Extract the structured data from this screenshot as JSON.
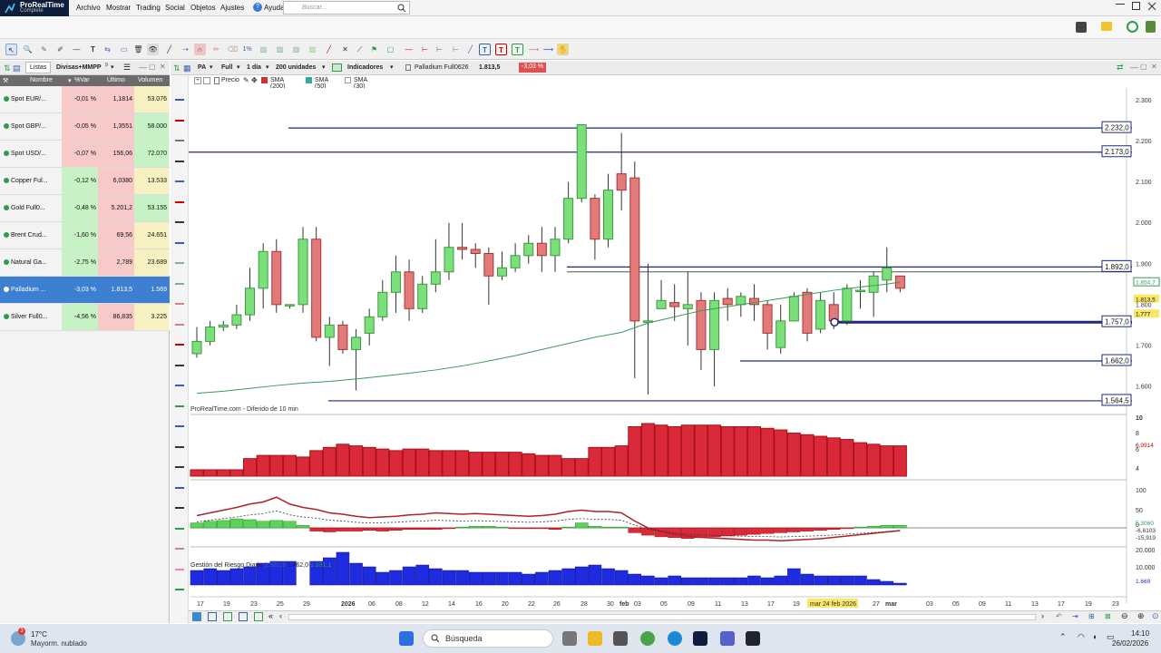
{
  "app": {
    "name": "ProRealTime",
    "edition": "Complete"
  },
  "menu": [
    "Archivo",
    "Mostrar",
    "Trading",
    "Social",
    "Objetos",
    "Ajustes",
    "Ayuda"
  ],
  "search": {
    "placeholder": "Buscar..."
  },
  "watchlist": {
    "tab": "Listas",
    "list_name": "Divisas+MMPP",
    "list_count": "9",
    "columns": [
      "Nombre",
      "%Var",
      "Último",
      "Volumen"
    ],
    "rows": [
      {
        "name": "Spot EUR/...",
        "var": "-0,01 %",
        "last": "1,1814",
        "vol": "53.076"
      },
      {
        "name": "Spot GBP/...",
        "var": "-0,05 %",
        "last": "1,3551",
        "vol": "58.000"
      },
      {
        "name": "Spot USD/...",
        "var": "-0,07 %",
        "last": "156,06",
        "vol": "72.070"
      },
      {
        "name": "Copper Ful...",
        "var": "-0,12 %",
        "last": "6,0380",
        "vol": "13.533"
      },
      {
        "name": "Gold Full0...",
        "var": "-0,48 %",
        "last": "5.201,2",
        "vol": "53.155"
      },
      {
        "name": "Brent Crud...",
        "var": "-1,60 %",
        "last": "69,56",
        "vol": "24.651"
      },
      {
        "name": "Natural Ga...",
        "var": "-2,75 %",
        "last": "2,789",
        "vol": "23.689"
      },
      {
        "name": "Palladium ...",
        "var": "-3,03 %",
        "last": "1.813,5",
        "vol": "1.569",
        "selected": true
      },
      {
        "name": "Silver Full0...",
        "var": "-4,56 %",
        "last": "86,835",
        "vol": "3.225"
      }
    ]
  },
  "chart_header": {
    "ticker": "PA",
    "mode": "Full",
    "timeframe": "1 día",
    "units": "200 unidades",
    "indicators": "Indicadores",
    "instrument": "Palladium Full0626",
    "price": "1.813,5",
    "change": "-3,03 %"
  },
  "legend": {
    "price": "Precio",
    "sma200": "SMA (200)",
    "sma50": "SMA (50)",
    "sma30": "SMA (30)"
  },
  "chart_source": "ProRealTime.com - Diferido de 10 min",
  "risk_bar": {
    "label": "Gestión del Riesgo Diario",
    "v1": "1.592,9",
    "v2": "1.462,0",
    "v3": "1.331,1"
  },
  "price_levels": {
    "boxes": [
      "2.232,0",
      "2.173,0",
      "1.892,0",
      "1.757,0",
      "1.662,0",
      "1.564,5"
    ],
    "current_a": "1.813,5",
    "current_b": "1.777",
    "sma_value": "1.854,7"
  },
  "y_ticks": [
    "2.300",
    "2.200",
    "2.100",
    "2.000",
    "1.900",
    "1.800",
    "1.700",
    "1.600"
  ],
  "vol_ticks": [
    "10",
    "8",
    "6",
    "4"
  ],
  "vol_value": "6,9914",
  "osc_ticks": [
    "100",
    "50",
    "0"
  ],
  "osc_values": [
    "5,3060",
    "-6,6103",
    "-15,919"
  ],
  "vol2_ticks": [
    "20.000",
    "10.000"
  ],
  "vol2_value": "1.669",
  "x_labels": [
    "17",
    "19",
    "23",
    "25",
    "29",
    "2026",
    "06",
    "08",
    "12",
    "14",
    "16",
    "20",
    "22",
    "26",
    "28",
    "30",
    "feb",
    "03",
    "05",
    "09",
    "11",
    "13",
    "17",
    "19",
    "mar 24 feb 2026",
    "27",
    "mar",
    "03",
    "05",
    "09",
    "11",
    "13",
    "17",
    "19",
    "23",
    "25"
  ],
  "chart_data": {
    "type": "candlestick",
    "instrument": "Palladium Full0626",
    "ylim": [
      1540,
      2330
    ],
    "candles": [
      [
        1680,
        1710,
        1670,
        1745
      ],
      [
        1710,
        1745,
        1700,
        1760
      ],
      [
        1745,
        1750,
        1735,
        1760
      ],
      [
        1750,
        1775,
        1740,
        1800
      ],
      [
        1775,
        1840,
        1760,
        1890
      ],
      [
        1840,
        1930,
        1790,
        1950
      ],
      [
        1930,
        1800,
        1780,
        1960
      ],
      [
        1800,
        1800,
        1790,
        1800
      ],
      [
        1800,
        1960,
        1780,
        1990
      ],
      [
        1960,
        1720,
        1710,
        1990
      ],
      [
        1720,
        1750,
        1650,
        1770
      ],
      [
        1750,
        1690,
        1680,
        1760
      ],
      [
        1690,
        1720,
        1590,
        1740
      ],
      [
        1730,
        1770,
        1700,
        1790
      ],
      [
        1770,
        1830,
        1760,
        1860
      ],
      [
        1830,
        1880,
        1780,
        1920
      ],
      [
        1880,
        1790,
        1760,
        1910
      ],
      [
        1790,
        1850,
        1780,
        1870
      ],
      [
        1850,
        1880,
        1830,
        1960
      ],
      [
        1880,
        1940,
        1860,
        2000
      ],
      [
        1940,
        1935,
        1910,
        2000
      ],
      [
        1935,
        1925,
        1890,
        1950
      ],
      [
        1925,
        1870,
        1800,
        1940
      ],
      [
        1870,
        1890,
        1860,
        1930
      ],
      [
        1890,
        1920,
        1880,
        1950
      ],
      [
        1920,
        1950,
        1900,
        1970
      ],
      [
        1950,
        1920,
        1880,
        1990
      ],
      [
        1920,
        1960,
        1880,
        1990
      ],
      [
        1960,
        2060,
        1950,
        2100
      ],
      [
        2060,
        2240,
        2050,
        2240
      ],
      [
        2060,
        1960,
        1910,
        2070
      ],
      [
        1960,
        2080,
        1940,
        2120
      ],
      [
        2120,
        2080,
        2030,
        2220
      ],
      [
        2110,
        1760,
        1620,
        2150
      ],
      [
        1760,
        1760,
        1580,
        1900
      ],
      [
        1790,
        1810,
        1790,
        1860
      ],
      [
        1805,
        1795,
        1760,
        1850
      ],
      [
        1790,
        1800,
        1700,
        1880
      ],
      [
        1810,
        1690,
        1640,
        1830
      ],
      [
        1690,
        1810,
        1600,
        1830
      ],
      [
        1815,
        1800,
        1760,
        1840
      ],
      [
        1800,
        1820,
        1770,
        1830
      ],
      [
        1815,
        1800,
        1760,
        1850
      ],
      [
        1800,
        1730,
        1690,
        1810
      ],
      [
        1695,
        1760,
        1680,
        1800
      ],
      [
        1760,
        1820,
        1760,
        1830
      ],
      [
        1830,
        1730,
        1710,
        1840
      ],
      [
        1740,
        1810,
        1730,
        1830
      ],
      [
        1800,
        1760,
        1740,
        1830
      ],
      [
        1760,
        1840,
        1750,
        1850
      ],
      [
        1835,
        1835,
        1790,
        1860
      ],
      [
        1830,
        1870,
        1770,
        1880
      ],
      [
        1860,
        1890,
        1830,
        1940
      ],
      [
        1870,
        1840,
        1830,
        1870
      ]
    ],
    "sma50": [
      [
        0,
        1583
      ],
      [
        2,
        1588
      ],
      [
        4,
        1595
      ],
      [
        6,
        1602
      ],
      [
        8,
        1608
      ],
      [
        10,
        1612
      ],
      [
        12,
        1618
      ],
      [
        14,
        1625
      ],
      [
        16,
        1632
      ],
      [
        18,
        1640
      ],
      [
        20,
        1650
      ],
      [
        22,
        1662
      ],
      [
        24,
        1675
      ],
      [
        26,
        1690
      ],
      [
        28,
        1705
      ],
      [
        30,
        1720
      ],
      [
        32,
        1732
      ],
      [
        34,
        1755
      ],
      [
        36,
        1770
      ],
      [
        38,
        1785
      ],
      [
        40,
        1795
      ],
      [
        42,
        1805
      ],
      [
        44,
        1815
      ],
      [
        46,
        1825
      ],
      [
        48,
        1835
      ],
      [
        50,
        1843
      ],
      [
        52,
        1850
      ],
      [
        53,
        1855
      ]
    ],
    "volume": [
      0.4,
      0.4,
      0.4,
      0.4,
      1.1,
      1.3,
      1.3,
      1.3,
      1.2,
      1.6,
      1.8,
      2,
      1.9,
      1.8,
      1.7,
      1.6,
      1.7,
      1.7,
      1.6,
      1.6,
      1.6,
      1.5,
      1.5,
      1.5,
      1.5,
      1.4,
      1.3,
      1.3,
      1.1,
      1.1,
      1.8,
      1.8,
      1.9,
      3.1,
      3.3,
      3.2,
      3.1,
      3.2,
      3.2,
      3.2,
      3.1,
      3.1,
      3.1,
      3,
      2.9,
      2.7,
      2.6,
      2.5,
      2.4,
      2.3,
      2.1,
      2,
      1.9,
      1.9
    ],
    "osc_hist": [
      6,
      8,
      9,
      11,
      10,
      8,
      9,
      8,
      3,
      -4,
      -5,
      -4,
      -4,
      -3,
      -4,
      -3,
      -2,
      -2,
      -2,
      -1,
      1,
      2,
      2,
      1,
      -1,
      -1,
      -1,
      -2,
      1,
      6,
      2,
      1,
      1,
      -6,
      -9,
      -11,
      -12,
      -13,
      -12,
      -11,
      -10,
      -9,
      -8,
      -7,
      -6,
      -5,
      -4,
      -3,
      -2,
      -1,
      1,
      2,
      3,
      3
    ],
    "osc_line": [
      18,
      22,
      26,
      30,
      35,
      38,
      45,
      35,
      30,
      27,
      22,
      20,
      17,
      15,
      16,
      17,
      19,
      20,
      22,
      21,
      20,
      21,
      20,
      19,
      18,
      17,
      18,
      20,
      24,
      26,
      24,
      24,
      22,
      10,
      0,
      -5,
      -10,
      -12,
      -14,
      -15,
      -16,
      -17,
      -18,
      -18,
      -19,
      -18,
      -17,
      -16,
      -14,
      -12,
      -10,
      -8,
      -6,
      -4
    ],
    "vol2": [
      8,
      9,
      8,
      9,
      10,
      12,
      13,
      13,
      0,
      13,
      15,
      18,
      12,
      10,
      7,
      8,
      10,
      11,
      9,
      8,
      8,
      7,
      7,
      7,
      7,
      6,
      7,
      8,
      9,
      10,
      11,
      9,
      8,
      6,
      5,
      4,
      5,
      4,
      4,
      4,
      4,
      4,
      5,
      4,
      5,
      9,
      6,
      5,
      5,
      5,
      5,
      3,
      2,
      1
    ]
  }
}
